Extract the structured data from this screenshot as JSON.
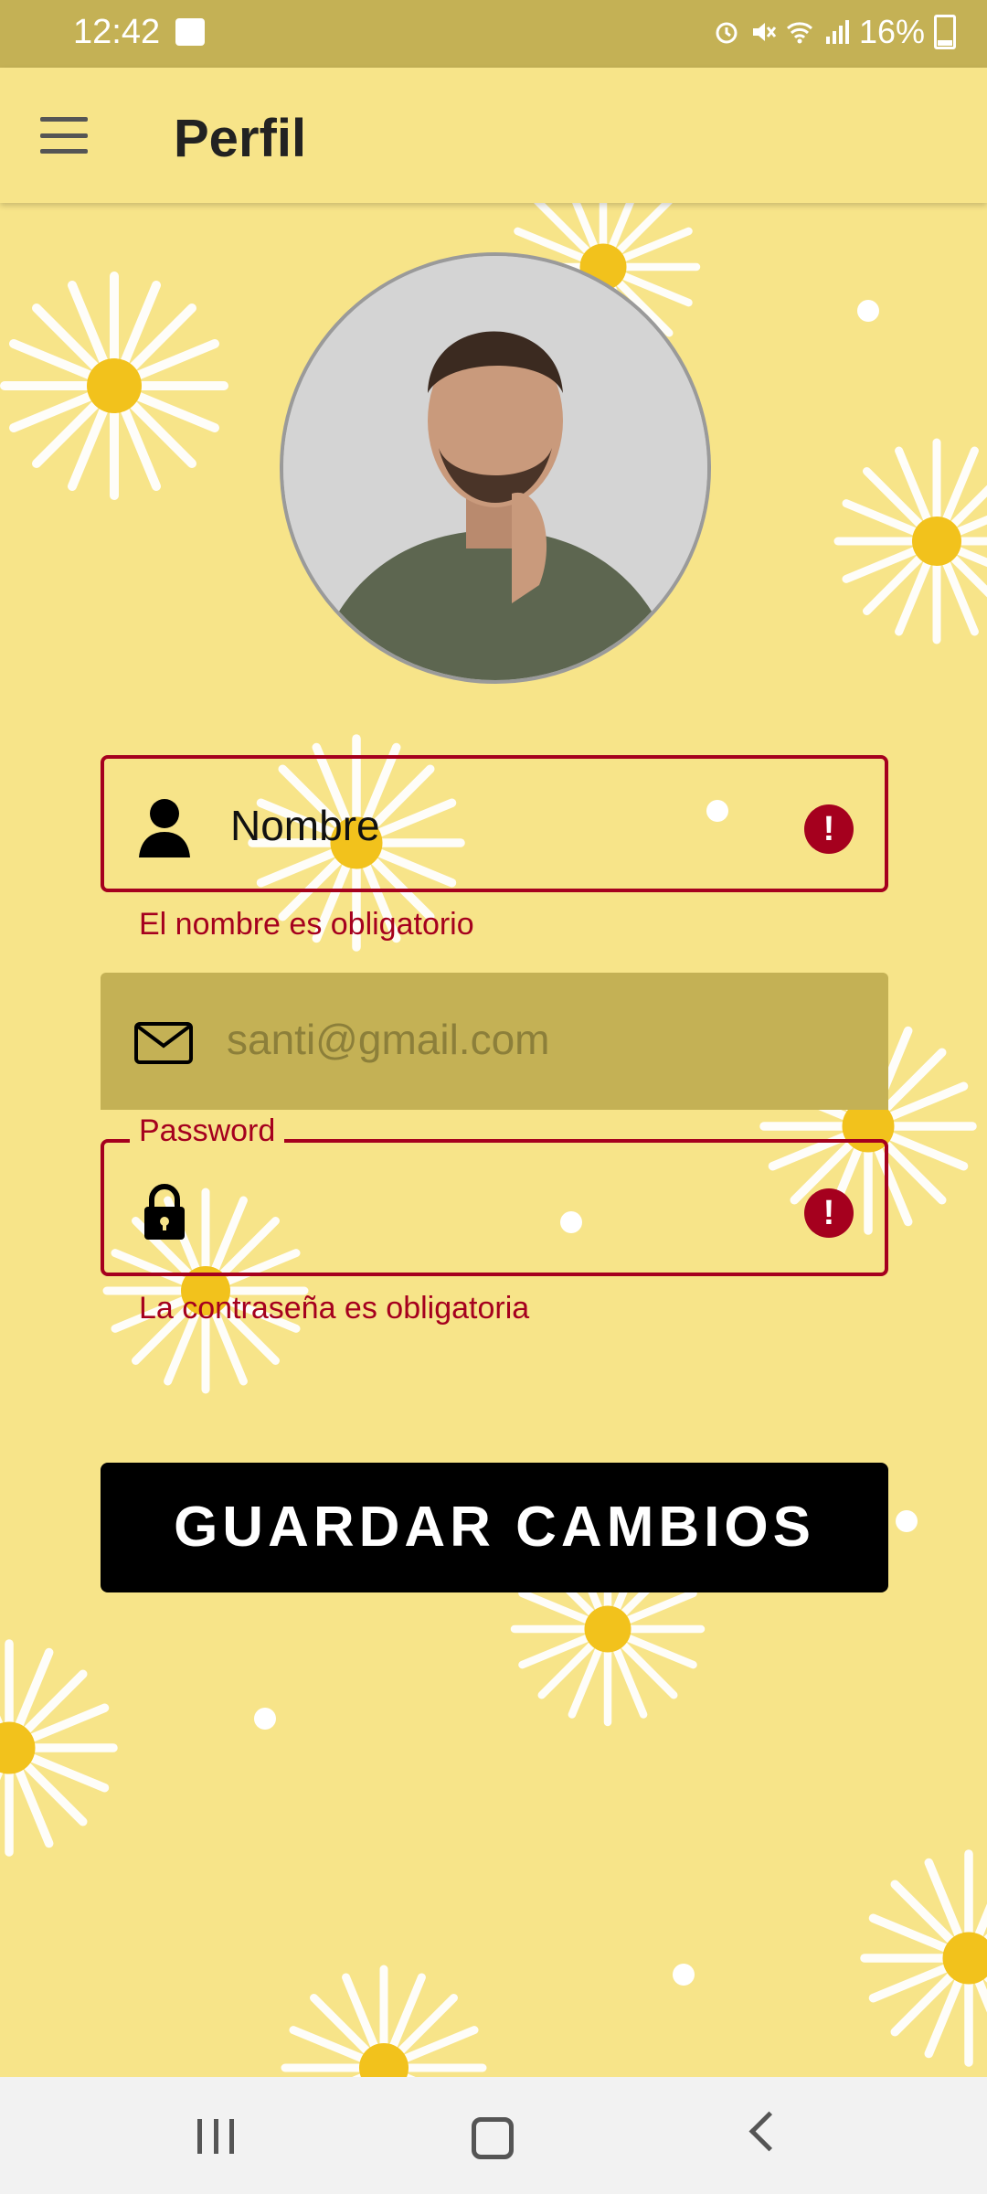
{
  "status_bar": {
    "time": "12:42",
    "battery": "16%",
    "icons": [
      "image-icon",
      "alarm-icon",
      "mute-icon",
      "wifi-icon",
      "signal-icon",
      "battery-icon"
    ]
  },
  "app_bar": {
    "title": "Perfil",
    "menu_icon": "hamburger-menu-icon"
  },
  "profile": {
    "avatar": "profile-photo"
  },
  "form": {
    "name": {
      "value": "Nombre",
      "icon": "person-icon",
      "error_icon": "error-icon",
      "error_text": "El nombre es obligatorio"
    },
    "email": {
      "value": "santi@gmail.com",
      "icon": "mail-icon"
    },
    "password": {
      "label": "Password",
      "value": "",
      "icon": "lock-icon",
      "error_icon": "error-icon",
      "error_text": "La contraseña es obligatoria"
    },
    "save_label": "GUARDAR CAMBIOS"
  },
  "colors": {
    "background": "#f7e489",
    "status_bar": "#c4b155",
    "error": "#a5001e",
    "button": "#000000"
  },
  "nav_bar": {
    "icons": [
      "recents-icon",
      "home-icon",
      "back-icon"
    ]
  }
}
